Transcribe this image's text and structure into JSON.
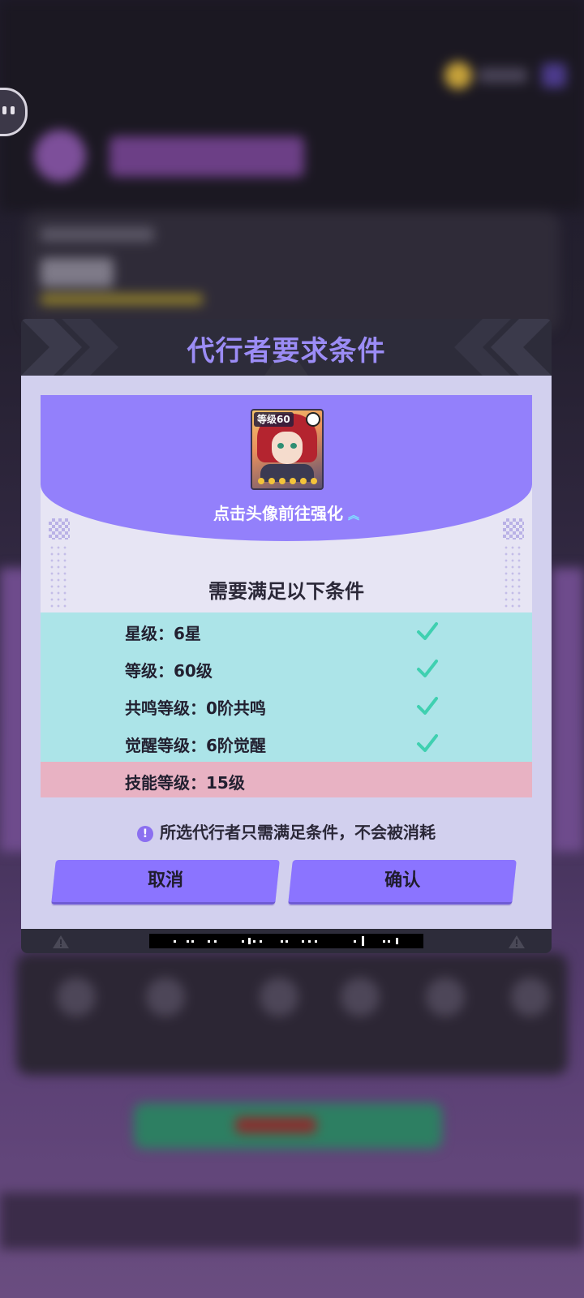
{
  "dialog": {
    "title": "代行者要求条件",
    "portrait": {
      "level_badge": "等级60",
      "star_count": 6
    },
    "enhance_link": "点击头像前往强化",
    "conditions_heading": "需要满足以下条件",
    "conditions": [
      {
        "label": "星级：6星",
        "met": true
      },
      {
        "label": "等级：60级",
        "met": true
      },
      {
        "label": "共鸣等级：0阶共鸣",
        "met": true
      },
      {
        "label": "觉醒等级：6阶觉醒",
        "met": true
      },
      {
        "label": "技能等级：15级",
        "met": false
      }
    ],
    "note": "所选代行者只需满足条件，不会被消耗",
    "cancel_label": "取消",
    "confirm_label": "确认"
  },
  "colors": {
    "title": "#9b8cf5",
    "met_row": "#ace4e8",
    "unmet_row": "#e8b2c3",
    "button": "#8b74ff",
    "check": "#3fd0b0"
  }
}
